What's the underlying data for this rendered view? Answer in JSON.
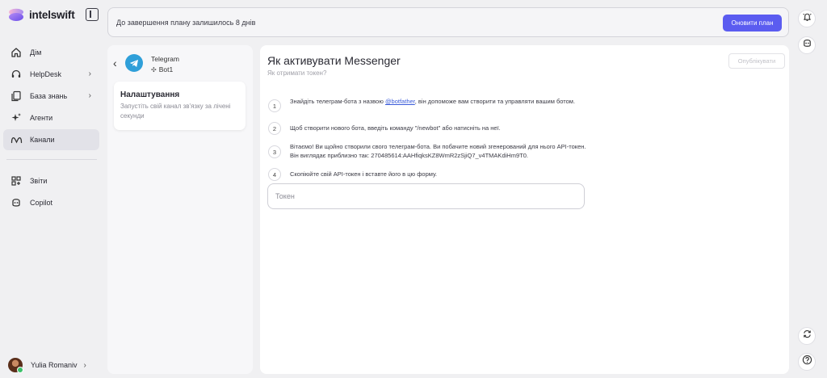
{
  "app": {
    "name": "intelswift"
  },
  "sidebar": {
    "items": [
      {
        "label": "Дім",
        "icon": "home-icon",
        "active": false,
        "has_chevron": false
      },
      {
        "label": "HelpDesk",
        "icon": "headset-icon",
        "active": false,
        "has_chevron": true
      },
      {
        "label": "База знань",
        "icon": "knowledge-base-icon",
        "active": false,
        "has_chevron": true
      },
      {
        "label": "Агенти",
        "icon": "sparkle-icon",
        "active": false,
        "has_chevron": false
      },
      {
        "label": "Канали",
        "icon": "channels-icon",
        "active": true,
        "has_chevron": false
      }
    ],
    "secondary_items": [
      {
        "label": "Звіти",
        "icon": "reports-icon"
      },
      {
        "label": "Copilot",
        "icon": "copilot-icon"
      }
    ],
    "user": {
      "name": "Yulia Romaniv"
    }
  },
  "banner": {
    "text": "До завершення плану залишилось 8 днів",
    "button_label": "Оновити план"
  },
  "channel": {
    "name": "Telegram",
    "bot_name": "Bot1",
    "settings_title": "Налаштування",
    "settings_subtitle": "Запустіть свій канал зв'язку за лічені секунди"
  },
  "main": {
    "title": "Як активувати Messenger",
    "subtitle": "Як отримати токен?",
    "publish_label": "Опублікувати",
    "steps": [
      {
        "num": "1",
        "text_before": "Знайдіть телеграм-бота з назвою ",
        "link": "@botfather",
        "text_after": ", він допоможе вам створити та управляти вашим ботом."
      },
      {
        "num": "2",
        "text_before": "Щоб створити нового бота, введіть команду \"/newbot\" або натисніть на неї.",
        "link": "",
        "text_after": ""
      },
      {
        "num": "3",
        "text_before": "Вітаємо! Ви щойно створили свого телеграм-бота. Ви побачите новий згенерований для нього API-токен. Він виглядає приблизно так: 270485614:AAHfiqksKZ8WmR2zSjiQ7_v4TMAKdiHm9T0.",
        "link": "",
        "text_after": ""
      },
      {
        "num": "4",
        "text_before": "Скопіюйте свій API-токен і вставте його в цю форму.",
        "link": "",
        "text_after": ""
      }
    ],
    "token_placeholder": "Токен"
  },
  "colors": {
    "accent": "#5b5cf0",
    "telegram": "#2f9fd9",
    "link": "#3a5bd9",
    "background": "#f0f0f2"
  }
}
